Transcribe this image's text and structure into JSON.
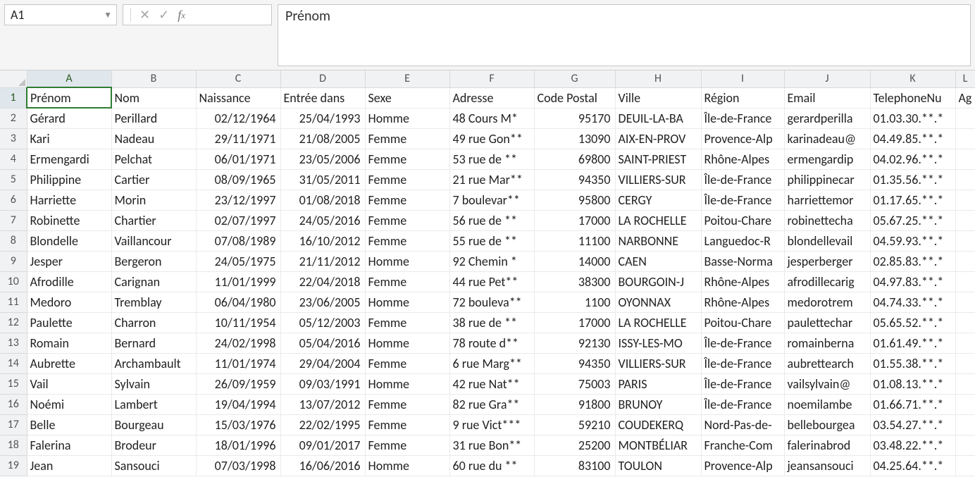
{
  "active_cell": "A1",
  "formula_value": "Prénom",
  "column_letters": [
    "A",
    "B",
    "C",
    "D",
    "E",
    "F",
    "G",
    "H",
    "I",
    "J",
    "K",
    "L"
  ],
  "column_last_partial": "Ag",
  "row_numbers": [
    1,
    2,
    3,
    4,
    5,
    6,
    7,
    8,
    9,
    10,
    11,
    12,
    13,
    14,
    15,
    16,
    17,
    18,
    19
  ],
  "headers": {
    "prenom": "Prénom",
    "nom": "Nom",
    "naissance": "Naissance",
    "entree": "Entrée dans",
    "sexe": "Sexe",
    "adresse": "Adresse",
    "cp": "Code Postal",
    "ville": "Ville",
    "region": "Région",
    "email": "Email",
    "tel": "TelephoneNu"
  },
  "rows": [
    {
      "prenom": "Gérard",
      "nom": "Perillard",
      "naissance": "02/12/1964",
      "entree": "25/04/1993",
      "sexe": "Homme",
      "adresse": "48 Cours M*",
      "cp": "95170",
      "ville": "DEUIL-LA-BA",
      "region": "Île-de-France",
      "email": "gerardperilla",
      "tel": "01.03.30.**.*"
    },
    {
      "prenom": "Kari",
      "nom": "Nadeau",
      "naissance": "29/11/1971",
      "entree": "21/08/2005",
      "sexe": "Femme",
      "adresse": "49 rue Gon**",
      "cp": "13090",
      "ville": "AIX-EN-PROV",
      "region": "Provence-Alp",
      "email": "karinadeau@",
      "tel": "04.49.85.**.*"
    },
    {
      "prenom": "Ermengardi",
      "nom": "Pelchat",
      "naissance": "06/01/1971",
      "entree": "23/05/2006",
      "sexe": "Femme",
      "adresse": "53 rue de **",
      "cp": "69800",
      "ville": "SAINT-PRIEST",
      "region": "Rhône-Alpes",
      "email": "ermengardip",
      "tel": "04.02.96.**.*"
    },
    {
      "prenom": "Philippine",
      "nom": "Cartier",
      "naissance": "08/09/1965",
      "entree": "31/05/2011",
      "sexe": "Femme",
      "adresse": "21 rue Mar**",
      "cp": "94350",
      "ville": "VILLIERS-SUR",
      "region": "Île-de-France",
      "email": "philippinecar",
      "tel": "01.35.56.**.*"
    },
    {
      "prenom": "Harriette",
      "nom": "Morin",
      "naissance": "23/12/1997",
      "entree": "01/08/2018",
      "sexe": "Femme",
      "adresse": "7 boulevar**",
      "cp": "95800",
      "ville": "CERGY",
      "region": "Île-de-France",
      "email": "harriettemor",
      "tel": "01.17.65.**.*"
    },
    {
      "prenom": "Robinette",
      "nom": "Chartier",
      "naissance": "02/07/1997",
      "entree": "24/05/2016",
      "sexe": "Femme",
      "adresse": "56 rue de **",
      "cp": "17000",
      "ville": "LA ROCHELLE",
      "region": "Poitou-Chare",
      "email": "robinettecha",
      "tel": "05.67.25.**.*"
    },
    {
      "prenom": "Blondelle",
      "nom": "Vaillancour",
      "naissance": "07/08/1989",
      "entree": "16/10/2012",
      "sexe": "Femme",
      "adresse": "55 rue de **",
      "cp": "11100",
      "ville": "NARBONNE",
      "region": "Languedoc-R",
      "email": "blondellevail",
      "tel": "04.59.93.**.*"
    },
    {
      "prenom": "Jesper",
      "nom": "Bergeron",
      "naissance": "24/05/1975",
      "entree": "21/11/2012",
      "sexe": "Homme",
      "adresse": "92 Chemin *",
      "cp": "14000",
      "ville": "CAEN",
      "region": "Basse-Norma",
      "email": "jesperberger",
      "tel": "02.85.83.**.*"
    },
    {
      "prenom": "Afrodille",
      "nom": "Carignan",
      "naissance": "11/01/1999",
      "entree": "22/04/2018",
      "sexe": "Femme",
      "adresse": "44 rue Pet**",
      "cp": "38300",
      "ville": "BOURGOIN-J",
      "region": "Rhône-Alpes",
      "email": "afrodillecarig",
      "tel": "04.97.83.**.*"
    },
    {
      "prenom": "Medoro",
      "nom": "Tremblay",
      "naissance": "06/04/1980",
      "entree": "23/06/2005",
      "sexe": "Homme",
      "adresse": "72 bouleva**",
      "cp": "1100",
      "ville": "OYONNAX",
      "region": "Rhône-Alpes",
      "email": "medorotrem",
      "tel": "04.74.33.**.*"
    },
    {
      "prenom": "Paulette",
      "nom": "Charron",
      "naissance": "10/11/1954",
      "entree": "05/12/2003",
      "sexe": "Femme",
      "adresse": "38 rue de **",
      "cp": "17000",
      "ville": "LA ROCHELLE",
      "region": "Poitou-Chare",
      "email": "paulettechar",
      "tel": "05.65.52.**.*"
    },
    {
      "prenom": "Romain",
      "nom": "Bernard",
      "naissance": "24/02/1998",
      "entree": "05/04/2016",
      "sexe": "Homme",
      "adresse": "78 route d**",
      "cp": "92130",
      "ville": "ISSY-LES-MO",
      "region": "Île-de-France",
      "email": "romainberna",
      "tel": "01.61.49.**.*"
    },
    {
      "prenom": "Aubrette",
      "nom": "Archambault",
      "naissance": "11/01/1974",
      "entree": "29/04/2004",
      "sexe": "Femme",
      "adresse": "6 rue Marg**",
      "cp": "94350",
      "ville": "VILLIERS-SUR",
      "region": "Île-de-France",
      "email": "aubrettearch",
      "tel": "01.55.38.**.*"
    },
    {
      "prenom": "Vail",
      "nom": "Sylvain",
      "naissance": "26/09/1959",
      "entree": "09/03/1991",
      "sexe": "Homme",
      "adresse": "42 rue Nat**",
      "cp": "75003",
      "ville": "PARIS",
      "region": "Île-de-France",
      "email": "vailsylvain@",
      "tel": "01.08.13.**.*"
    },
    {
      "prenom": "Noémi",
      "nom": "Lambert",
      "naissance": "19/04/1994",
      "entree": "13/07/2012",
      "sexe": "Femme",
      "adresse": "82 rue Gra**",
      "cp": "91800",
      "ville": "BRUNOY",
      "region": "Île-de-France",
      "email": "noemilambe",
      "tel": "01.66.71.**.*"
    },
    {
      "prenom": "Belle",
      "nom": "Bourgeau",
      "naissance": "15/03/1976",
      "entree": "22/02/1995",
      "sexe": "Femme",
      "adresse": "9 rue Vict***",
      "cp": "59210",
      "ville": "COUDEKERQ",
      "region": "Nord-Pas-de-",
      "email": "bellebourgea",
      "tel": "03.54.27.**.*"
    },
    {
      "prenom": "Falerina",
      "nom": "Brodeur",
      "naissance": "18/01/1996",
      "entree": "09/01/2017",
      "sexe": "Femme",
      "adresse": "31 rue Bon**",
      "cp": "25200",
      "ville": "MONTBÉLIAR",
      "region": "Franche-Com",
      "email": "falerinabrod",
      "tel": "03.48.22.**.*"
    },
    {
      "prenom": "Jean",
      "nom": "Sansouci",
      "naissance": "07/03/1998",
      "entree": "16/06/2016",
      "sexe": "Homme",
      "adresse": "60 rue du **",
      "cp": "83100",
      "ville": "TOULON",
      "region": "Provence-Alp",
      "email": "jeansansouci",
      "tel": "04.25.64.**.*"
    }
  ]
}
